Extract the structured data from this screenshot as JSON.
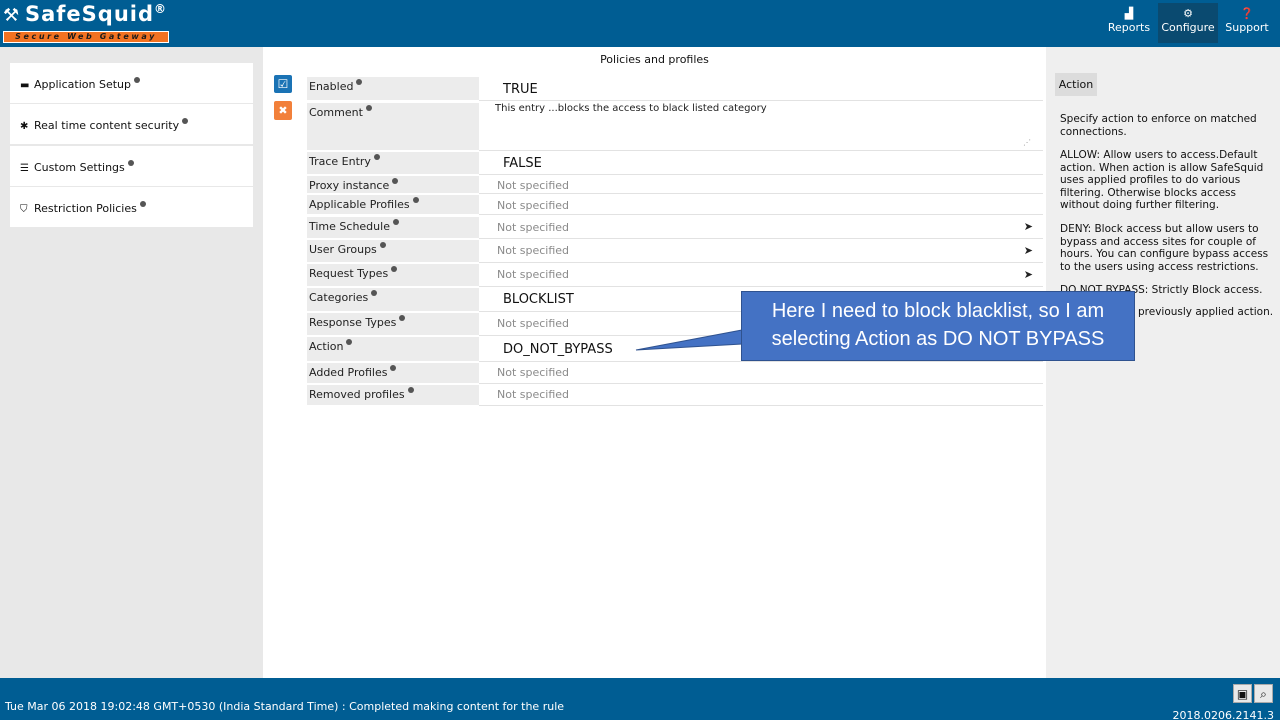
{
  "app": {
    "brand": "SafeSquid",
    "brand_mark": "®",
    "tagline": "Secure Web Gateway"
  },
  "nav": [
    {
      "label": "Reports",
      "icon": "chart-icon"
    },
    {
      "label": "Configure",
      "icon": "cogs-icon",
      "active": true
    },
    {
      "label": "Support",
      "icon": "question-icon"
    }
  ],
  "sidebar": {
    "items": [
      {
        "label": "Application Setup",
        "icon": "briefcase-icon"
      },
      {
        "label": "Real time content security",
        "icon": "bug-icon"
      },
      {
        "label": "Custom Settings",
        "icon": "sliders-icon"
      },
      {
        "label": "Restriction Policies",
        "icon": "shield-icon"
      }
    ]
  },
  "main": {
    "title": "Policies and profiles",
    "fields": {
      "enabled": {
        "label": "Enabled",
        "value": "TRUE"
      },
      "comment": {
        "label": "Comment",
        "value": "This entry ...blocks the access to black listed category"
      },
      "trace_entry": {
        "label": "Trace Entry",
        "value": "FALSE"
      },
      "proxy_instance": {
        "label": "Proxy instance",
        "value": "Not specified"
      },
      "applicable_profiles": {
        "label": "Applicable Profiles",
        "value": "Not specified"
      },
      "time_schedule": {
        "label": "Time Schedule",
        "value": "Not specified"
      },
      "user_groups": {
        "label": "User Groups",
        "value": "Not specified"
      },
      "request_types": {
        "label": "Request Types",
        "value": "Not specified"
      },
      "categories": {
        "label": "Categories",
        "value": "BLOCKLIST"
      },
      "response_types": {
        "label": "Response Types",
        "value": "Not specified"
      },
      "action": {
        "label": "Action",
        "value": "DO_NOT_BYPASS"
      },
      "added_profiles": {
        "label": "Added Profiles",
        "value": "Not specified"
      },
      "removed_profiles": {
        "label": "Removed profiles",
        "value": "Not specified"
      }
    }
  },
  "help": {
    "tab": "Action",
    "paragraphs": [
      "Specify action to enforce on matched connections.",
      "ALLOW: Allow users to access.Default action. When action is allow SafeSquid uses applied profiles to do various filtering. Otherwise blocks access without doing further filtering.",
      "DENY: Block access but allow users to bypass and access sites for couple of hours. You can configure bypass access to the users using access restrictions.",
      "DO NOT BYPASS: Strictly Block access.",
      "previously applied action."
    ]
  },
  "callout": {
    "line1": "Here I need to block  blacklist, so I am",
    "line2": "selecting Action as DO NOT BYPASS"
  },
  "footer": {
    "status": "Tue Mar 06 2018 19:02:48 GMT+0530 (India Standard Time) : Completed making content for the rule",
    "version": "2018.0206.2141.3"
  },
  "colors": {
    "header_bg": "#005d93",
    "active_nav": "#0a4a70",
    "accent_orange": "#f27221",
    "callout_bg": "#4472c4"
  }
}
